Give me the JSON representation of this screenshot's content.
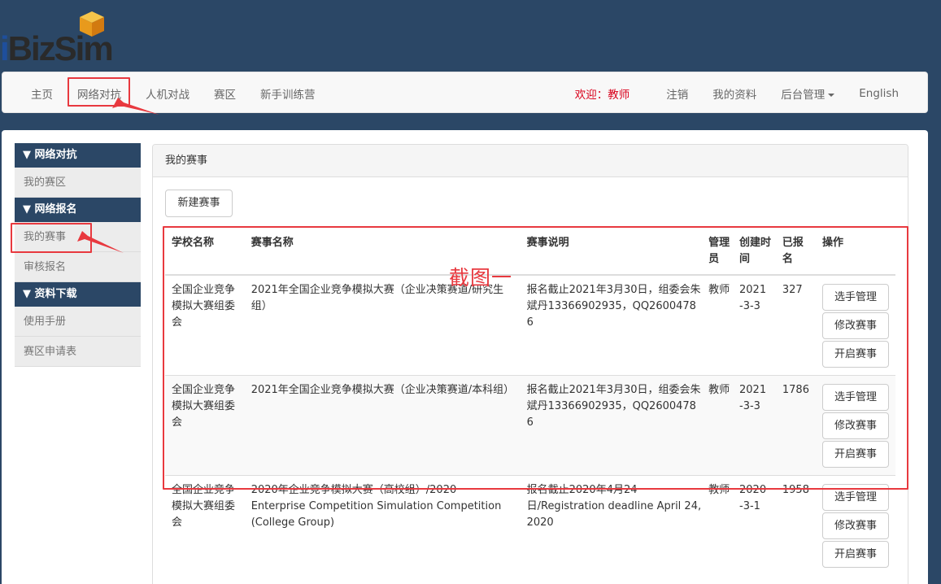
{
  "logo": {
    "text_i": "i",
    "text_rest": "BizSim"
  },
  "nav": {
    "left": [
      "主页",
      "网络对抗",
      "人机对战",
      "赛区",
      "新手训练营"
    ],
    "welcome": "欢迎：教师",
    "logout": "注销",
    "profile": "我的资料",
    "admin": "后台管理",
    "language": "English"
  },
  "sidebar": {
    "sections": [
      {
        "title": "▼ 网络对抗",
        "items": [
          "我的赛区"
        ]
      },
      {
        "title": "▼ 网络报名",
        "items": [
          "我的赛事",
          "审核报名"
        ]
      },
      {
        "title": "▼ 资料下载",
        "items": [
          "使用手册",
          "赛区申请表"
        ]
      }
    ]
  },
  "panel": {
    "title": "我的赛事",
    "new_button": "新建赛事",
    "annotation": "截图一",
    "columns": [
      "学校名称",
      "赛事名称",
      "赛事说明",
      "管理员",
      "创建时间",
      "已报名",
      "操作"
    ],
    "rows": [
      {
        "school": "全国企业竞争模拟大赛组委会",
        "name": "2021年全国企业竞争模拟大赛（企业决策赛道/研究生组）",
        "desc": "报名截止2021年3月30日，组委会朱斌丹13366902935，QQ26004786",
        "admin": "教师",
        "created": "2021-3-3",
        "count": "327"
      },
      {
        "school": "全国企业竞争模拟大赛组委会",
        "name": "2021年全国企业竞争模拟大赛（企业决策赛道/本科组）",
        "desc": "报名截止2021年3月30日，组委会朱斌丹13366902935，QQ26004786",
        "admin": "教师",
        "created": "2021-3-3",
        "count": "1786"
      },
      {
        "school": "全国企业竞争模拟大赛组委会",
        "name": "2020年企业竞争模拟大赛（高校组）/2020 Enterprise Competition Simulation Competition (College Group)",
        "desc": "报名截止2020年4月24日/Registration deadline April 24, 2020",
        "admin": "教师",
        "created": "2020-3-1",
        "count": "1958"
      }
    ],
    "actions": [
      "选手管理",
      "修改赛事",
      "开启赛事"
    ]
  },
  "colors": {
    "nav_bg": "#2b4766",
    "highlight": "#e8393f",
    "welcome": "#d9001b"
  }
}
